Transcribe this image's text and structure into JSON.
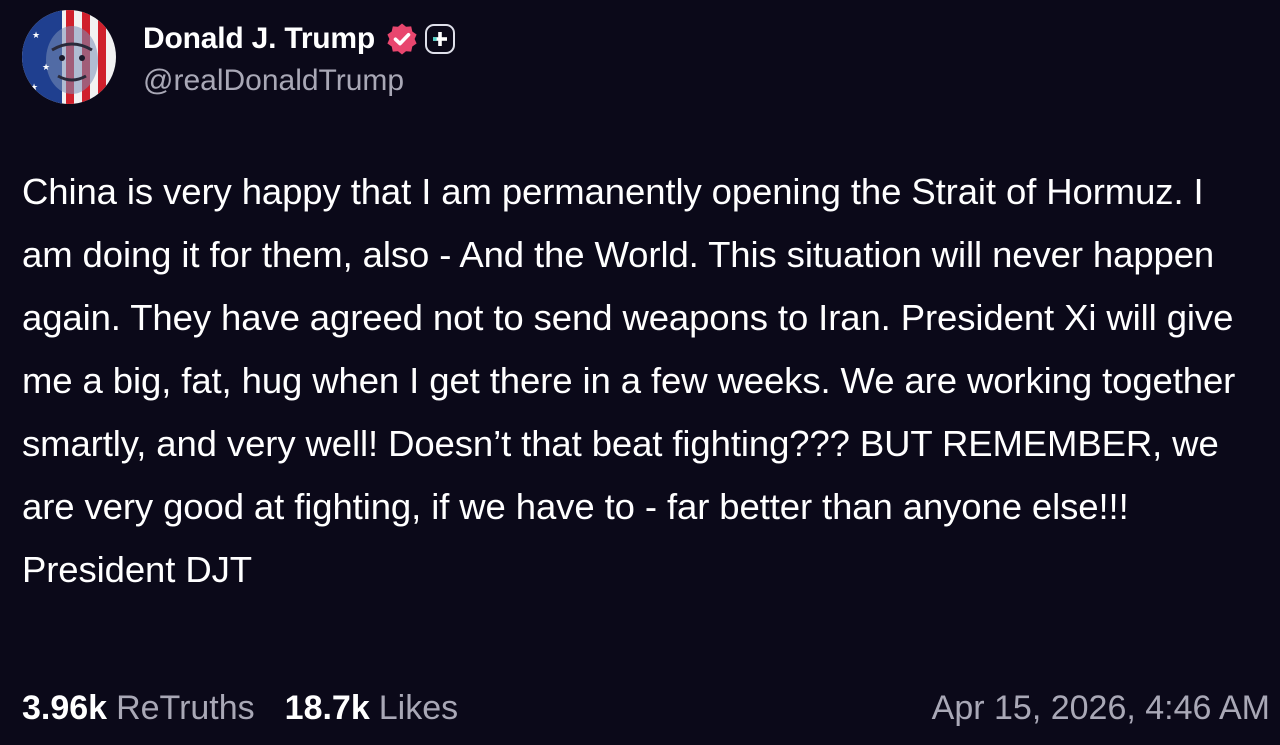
{
  "author": {
    "display_name": "Donald J. Trump",
    "handle": "@realDonaldTrump",
    "verified_badge_icon": "verified-check-icon",
    "verified_color": "#e8466e",
    "plus_badge_icon": "plus-icon"
  },
  "post": {
    "text": "China is very happy that I am permanently opening the Strait of Hormuz. I am doing it for them, also - And the World. This situation will never happen again. They have agreed not to send weapons to Iran. President Xi will give me a big, fat, hug when I get there in a few weeks. We are working together smartly, and very well! Doesn’t that beat fighting??? BUT REMEMBER, we are very good at fighting, if we have to - far better than anyone else!!! President DJT"
  },
  "stats": {
    "retruths_count": "3.96k",
    "retruths_label": "ReTruths",
    "likes_count": "18.7k",
    "likes_label": "Likes"
  },
  "timestamp": "Apr 15, 2026, 4:46 AM",
  "colors": {
    "background": "#0b0919",
    "text": "#ffffff",
    "secondary_text": "#a9a8b6"
  }
}
